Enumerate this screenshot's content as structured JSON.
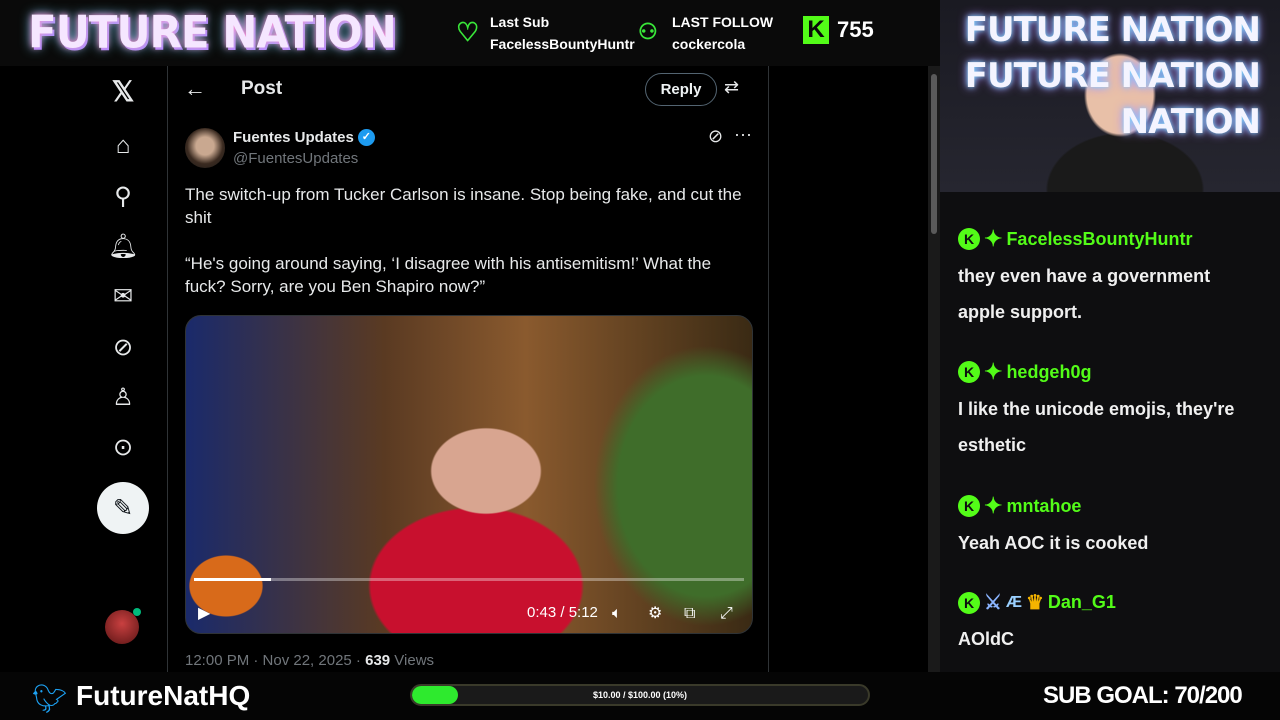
{
  "overlay": {
    "logo": "FUTURE NATION",
    "last_sub_label": "Last Sub",
    "last_sub_name": "FacelessBountyHuntr",
    "last_follow_label": "LAST FOLLOW",
    "last_follow_name": "cockercola",
    "kick_viewers": "755",
    "twitter_handle": "FutureNatHQ",
    "goal_text": "$10.00 / $100.00 (10%)",
    "goal_fraction": 0.1,
    "sub_goal": "SUB GOAL: 70/200",
    "accent_green": "#53fc18",
    "webcam_sign": [
      "FUTURE NATION",
      "FUTURE NATION",
      "NATION"
    ]
  },
  "nav": {
    "icons": [
      "x-logo-icon",
      "home-icon",
      "search-icon",
      "notifications-icon",
      "messages-icon",
      "grok-icon",
      "profile-icon",
      "more-icon",
      "compose-icon"
    ]
  },
  "post": {
    "title": "Post",
    "reply_label": "Reply",
    "author_name": "Fuentes Updates",
    "author_handle": "@FuentesUpdates",
    "text": "The switch-up from Tucker Carlson is insane. Stop being fake, and cut the shit\n\n“He's going around saying, ‘I disagree with his antisemitism!’ What the fuck? Sorry, are you Ben Shapiro now?”",
    "video_time": "0:43 / 5:12",
    "video_progress": 0.14,
    "timestamp": "12:00 PM · Nov 22, 2025 · ",
    "views_count": "639",
    "views_label": " Views",
    "verified_color": "#1d9bf0"
  },
  "chat": [
    {
      "user": "FacelessBountyHuntr",
      "text": "they even have a government apple support."
    },
    {
      "user": "hedgeh0g",
      "text": "I like the unicode emojis, they're esthetic"
    },
    {
      "user": "mntahoe",
      "text": "Yeah AOC it is cooked"
    },
    {
      "user": "Dan_G1",
      "text": "AOldC"
    }
  ]
}
